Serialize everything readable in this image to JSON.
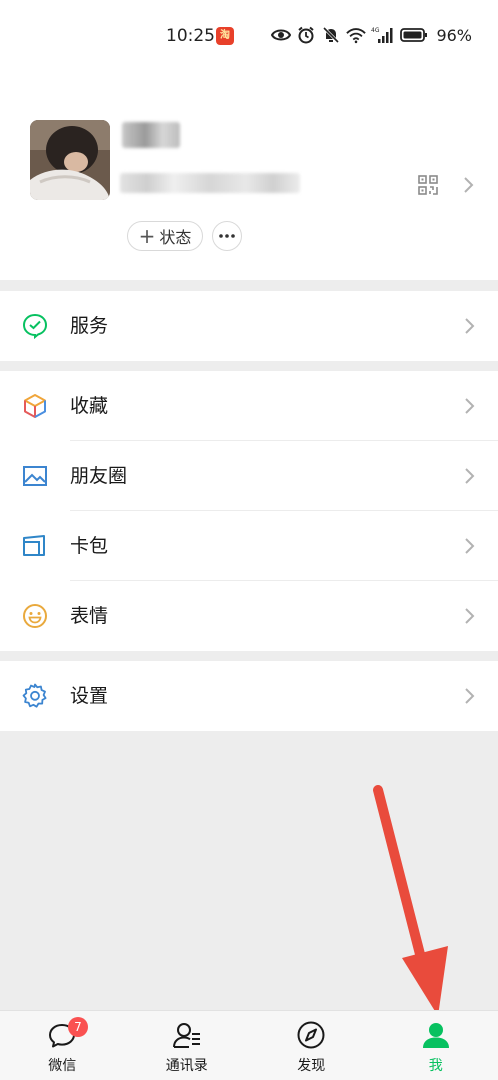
{
  "status_bar": {
    "time": "10:25",
    "app_icon_text": "淘",
    "battery_percent": "96%",
    "icons": [
      "eye-icon",
      "alarm-icon",
      "mute-icon",
      "wifi-icon",
      "signal-icon",
      "battery-icon"
    ],
    "network_label": "4G"
  },
  "profile": {
    "status_button_label": "状态",
    "status_button_plus": "+",
    "more_button_label": "···"
  },
  "menu": {
    "services_label": "服务",
    "favorites_label": "收藏",
    "moments_label": "朋友圈",
    "cards_label": "卡包",
    "stickers_label": "表情",
    "settings_label": "设置"
  },
  "tabbar": {
    "chats_label": "微信",
    "chats_badge": "7",
    "contacts_label": "通讯录",
    "discover_label": "发现",
    "me_label": "我"
  },
  "colors": {
    "accent": "#07c160",
    "badge": "#fa5151",
    "arrow": "#e94b3c",
    "background": "#ededed"
  }
}
